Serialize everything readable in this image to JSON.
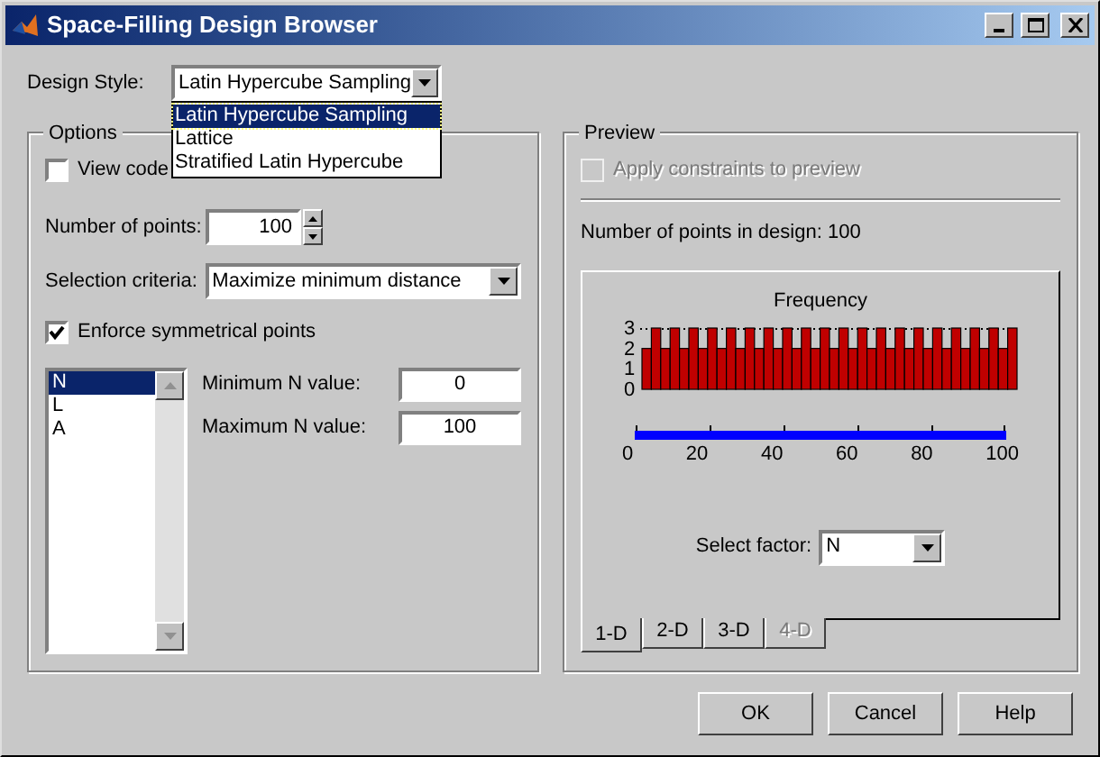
{
  "window": {
    "title": "Space-Filling Design Browser"
  },
  "design_style": {
    "label": "Design Style:",
    "value": "Latin Hypercube Sampling",
    "options": [
      {
        "label": "Latin Hypercube Sampling",
        "selected": true
      },
      {
        "label": "Lattice",
        "selected": false
      },
      {
        "label": "Stratified Latin Hypercube",
        "selected": false
      }
    ]
  },
  "options": {
    "title": "Options",
    "view_code": {
      "label": "View code",
      "checked": false
    },
    "number_of_points": {
      "label": "Number of points:",
      "value": "100"
    },
    "selection_criteria": {
      "label": "Selection criteria:",
      "value": "Maximize minimum distance"
    },
    "enforce_symmetrical": {
      "label": "Enforce symmetrical points",
      "checked": true
    },
    "factors": [
      {
        "label": "N",
        "selected": true
      },
      {
        "label": "L",
        "selected": false
      },
      {
        "label": "A",
        "selected": false
      }
    ],
    "minimum": {
      "label": "Minimum N value:",
      "value": "0"
    },
    "maximum": {
      "label": "Maximum N value:",
      "value": "100"
    }
  },
  "preview": {
    "title": "Preview",
    "apply_constraints": {
      "label": "Apply constraints to preview",
      "checked": false,
      "disabled": true
    },
    "points_text": "Number of points in design: 100",
    "chart_data": {
      "type": "bar",
      "title": "Frequency",
      "categories": [
        null,
        null,
        null,
        null,
        null,
        null,
        null,
        null,
        null,
        null,
        null,
        null,
        null,
        null,
        null,
        null,
        null,
        null,
        null,
        null,
        null,
        null,
        null,
        null,
        null,
        null,
        null,
        null,
        null,
        null,
        null,
        null,
        null,
        null,
        null,
        null,
        null,
        null,
        null,
        null
      ],
      "yticks": [
        {
          "value": 0,
          "label": "0"
        },
        {
          "value": 1,
          "label": "1"
        },
        {
          "value": 2,
          "label": "2"
        },
        {
          "value": 3,
          "label": "3"
        }
      ],
      "ylim": [
        0,
        3
      ],
      "values": [
        2,
        3,
        2,
        3,
        2,
        3,
        2,
        3,
        2,
        3,
        2,
        3,
        2,
        3,
        2,
        3,
        2,
        3,
        2,
        3,
        2,
        3,
        2,
        3,
        2,
        3,
        2,
        3,
        2,
        3,
        2,
        3,
        2,
        3,
        2,
        3,
        2,
        3,
        2,
        3
      ]
    },
    "axis_labels": [
      "0",
      "20",
      "40",
      "60",
      "80",
      "100"
    ],
    "select_factor": {
      "label": "Select factor:",
      "value": "N"
    },
    "tabs": [
      {
        "label": "1-D",
        "selected": true,
        "disabled": false
      },
      {
        "label": "2-D",
        "selected": false,
        "disabled": false
      },
      {
        "label": "3-D",
        "selected": false,
        "disabled": false
      },
      {
        "label": "4-D",
        "selected": false,
        "disabled": true
      }
    ]
  },
  "buttons": [
    "OK",
    "Cancel",
    "Help"
  ]
}
